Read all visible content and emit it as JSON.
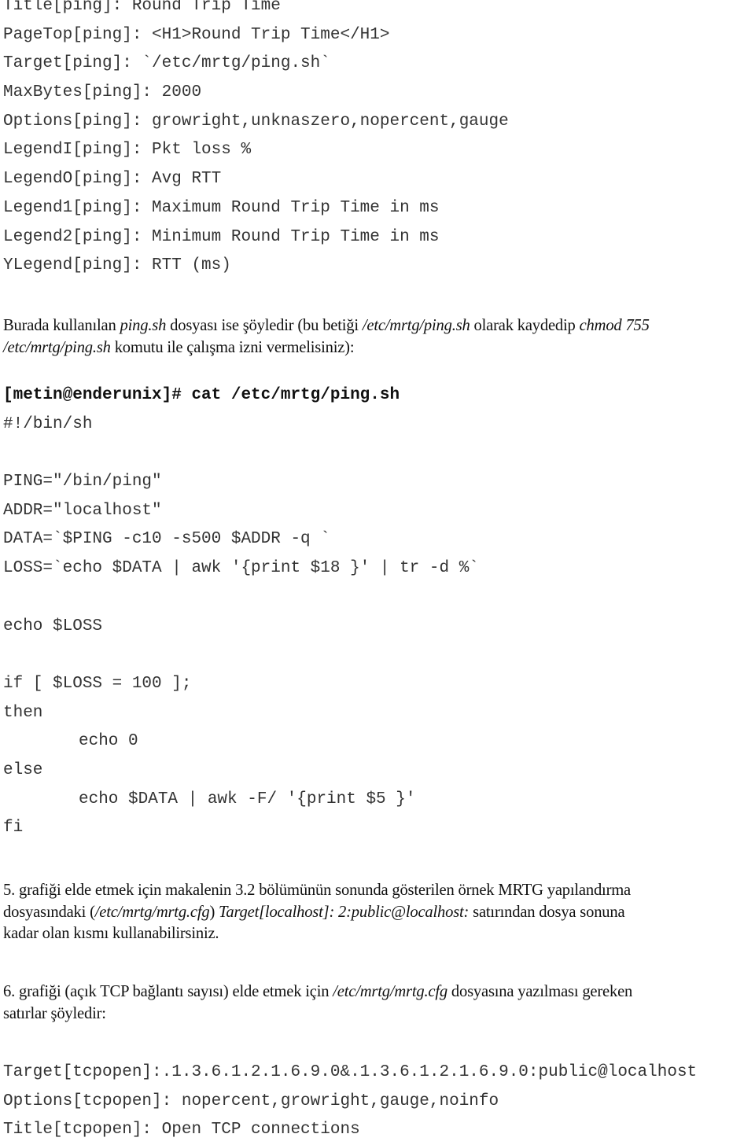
{
  "config_block": [
    {
      "text": "Title[ping]: Round Trip Time"
    },
    {
      "text": "PageTop[ping]: <H1>Round Trip Time</H1>"
    },
    {
      "text": "Target[ping]: `/etc/mrtg/ping.sh`"
    },
    {
      "text": "MaxBytes[ping]: 2000"
    },
    {
      "text": "Options[ping]: growright,unknaszero,nopercent,gauge"
    },
    {
      "text": "LegendI[ping]: Pkt loss %"
    },
    {
      "text": "LegendO[ping]: Avg RTT"
    },
    {
      "text": "Legend1[ping]: Maximum Round Trip Time in ms"
    },
    {
      "text": "Legend2[ping]: Minimum Round Trip Time in ms"
    },
    {
      "text": "YLegend[ping]: RTT (ms)"
    }
  ],
  "paragraph1": [
    [
      {
        "t": "Burada kullanılan "
      },
      {
        "t": "ping.sh",
        "i": true
      },
      {
        "t": " dosyası ise şöyledir (bu betiği "
      },
      {
        "t": "/etc/mrtg/ping.sh",
        "i": true
      },
      {
        "t": " olarak kaydedip "
      },
      {
        "t": "chmod 755",
        "i": true
      }
    ],
    [
      {
        "t": "/etc/mrtg/ping.sh",
        "i": true
      },
      {
        "t": " komutu ile çalışma izni vermelisiniz):"
      }
    ]
  ],
  "script_block": [
    {
      "text": "[metin@enderunix]# cat /etc/mrtg/ping.sh",
      "bold": true
    },
    {
      "text": "#!/bin/sh"
    },
    {
      "text": ""
    },
    {
      "text": "PING=\"/bin/ping\""
    },
    {
      "text": "ADDR=\"localhost\""
    },
    {
      "text": "DATA=`$PING -c10 -s500 $ADDR -q `"
    },
    {
      "text": "LOSS=`echo $DATA | awk '{print $18 }' | tr -d %`"
    },
    {
      "text": ""
    },
    {
      "text": "echo $LOSS"
    },
    {
      "text": ""
    },
    {
      "text": "if [ $LOSS = 100 ];"
    },
    {
      "text": "then"
    },
    {
      "text": "echo 0",
      "indent": true
    },
    {
      "text": "else"
    },
    {
      "text": "echo $DATA | awk -F/ '{print $5 }'",
      "indent": true
    },
    {
      "text": "fi"
    }
  ],
  "paragraph2": [
    [
      {
        "t": "5. grafiği elde etmek için makalenin 3.2 bölümünün sonunda gösterilen örnek MRTG yapılandırma"
      }
    ],
    [
      {
        "t": "dosyasındaki ("
      },
      {
        "t": "/etc/mrtg/mrtg.cfg",
        "i": true
      },
      {
        "t": ") "
      },
      {
        "t": "Target[localhost]: 2:public@localhost:",
        "i": true
      },
      {
        "t": " satırından dosya sonuna"
      }
    ],
    [
      {
        "t": "kadar olan kısmı kullanabilirsiniz."
      }
    ]
  ],
  "paragraph3": [
    [
      {
        "t": "6. grafiği (açık TCP bağlantı sayısı) elde etmek için "
      },
      {
        "t": "/etc/mrtg/mrtg.cfg",
        "i": true
      },
      {
        "t": " dosyasına yazılması gereken"
      }
    ],
    [
      {
        "t": "satırlar şöyledir:"
      }
    ]
  ],
  "tcp_block": [
    {
      "text": "Target[tcpopen]:.1.3.6.1.2.1.6.9.0&.1.3.6.1.2.1.6.9.0:public@localhost"
    },
    {
      "text": "Options[tcpopen]: nopercent,growright,gauge,noinfo"
    },
    {
      "text": "Title[tcpopen]: Open TCP connections"
    }
  ]
}
